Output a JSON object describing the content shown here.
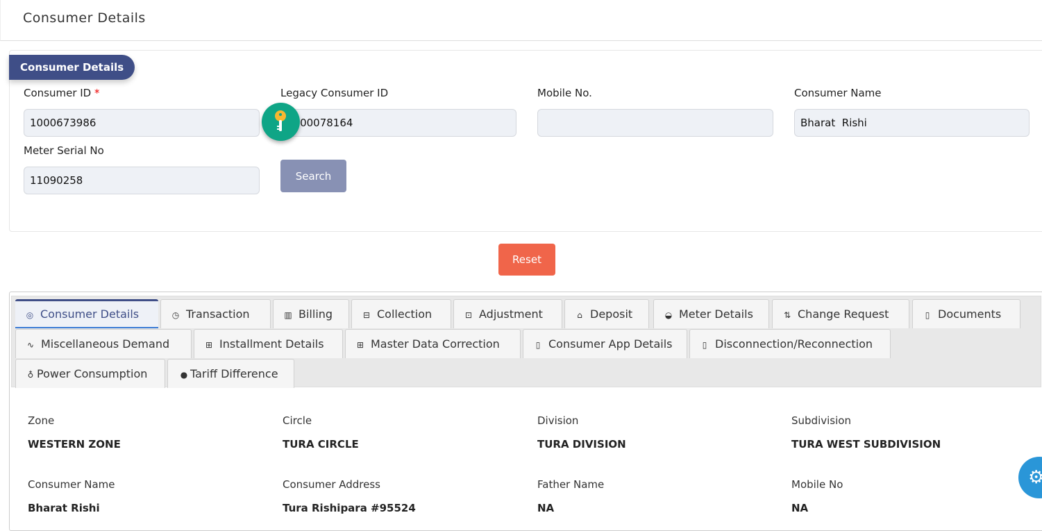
{
  "header": {
    "title": "Consumer Details"
  },
  "search": {
    "section_label": "Consumer Details",
    "consumer_id": {
      "label": "Consumer ID",
      "required": "*",
      "value": "1000673986"
    },
    "legacy_consumer_id": {
      "label": "Legacy Consumer ID",
      "value": "1000078164"
    },
    "mobile_no": {
      "label": "Mobile No.",
      "value": ""
    },
    "consumer_name": {
      "label": "Consumer Name",
      "value": "Bharat  Rishi"
    },
    "meter_serial_no": {
      "label": "Meter Serial No",
      "value": "11090258"
    },
    "search_label": "Search",
    "reset_label": "Reset"
  },
  "colors": {
    "primary": "#3f4e87",
    "reset": "#f0654a",
    "search": "#8891b4",
    "key_badge": "#0fa586"
  },
  "tabs": [
    {
      "label": "Consumer Details",
      "icon": "target-icon"
    },
    {
      "label": "Transaction",
      "icon": "clock-icon"
    },
    {
      "label": "Billing",
      "icon": "building-icon"
    },
    {
      "label": "Collection",
      "icon": "table-icon"
    },
    {
      "label": "Adjustment",
      "icon": "terminal-icon"
    },
    {
      "label": "Deposit",
      "icon": "bank-icon"
    },
    {
      "label": "Meter Details",
      "icon": "gauge-icon"
    },
    {
      "label": "Change Request",
      "icon": "git-pull-icon"
    },
    {
      "label": "Documents",
      "icon": "document-search-icon"
    },
    {
      "label": "Miscellaneous Demand",
      "icon": "pulse-icon"
    },
    {
      "label": "Installment Details",
      "icon": "plus-box-icon"
    },
    {
      "label": "Master Data Correction",
      "icon": "plus-box-icon"
    },
    {
      "label": "Consumer App Details",
      "icon": "mobile-icon"
    },
    {
      "label": "Disconnection/Reconnection",
      "icon": "mobile-icon"
    },
    {
      "label": "Power Consumption",
      "icon": "bulb-icon"
    },
    {
      "label": "Tariff Difference",
      "icon": "circle-icon"
    }
  ],
  "details": [
    {
      "label": "Zone",
      "value": "WESTERN ZONE"
    },
    {
      "label": "Circle",
      "value": "TURA CIRCLE"
    },
    {
      "label": "Division",
      "value": "TURA DIVISION"
    },
    {
      "label": "Subdivision",
      "value": "TURA WEST SUBDIVISION"
    },
    {
      "label": "Consumer Name",
      "value": "Bharat Rishi"
    },
    {
      "label": "Consumer Address",
      "value": "Tura Rishipara #95524"
    },
    {
      "label": "Father Name",
      "value": "NA"
    },
    {
      "label": "Mobile No",
      "value": "NA"
    }
  ]
}
